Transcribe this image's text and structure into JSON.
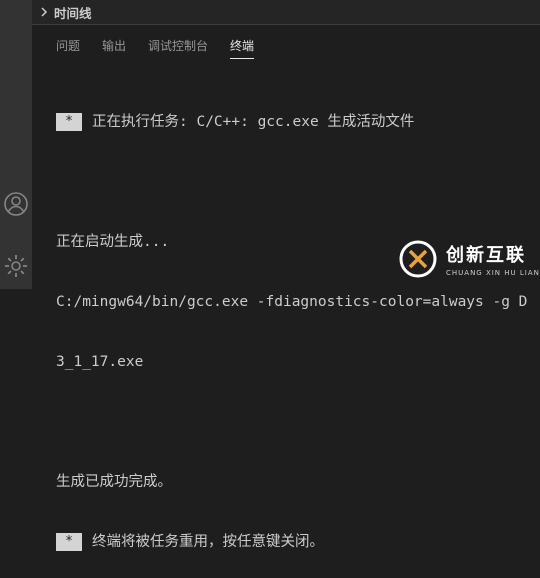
{
  "timeline": {
    "title": "时间线"
  },
  "panel": {
    "tabs": [
      {
        "label": "问题",
        "active": false
      },
      {
        "label": "输出",
        "active": false
      },
      {
        "label": "调试控制台",
        "active": false
      },
      {
        "label": "终端",
        "active": true
      }
    ]
  },
  "terminal": {
    "star": "*",
    "line1": "正在执行任务: C/C++: gcc.exe 生成活动文件",
    "line2": "正在启动生成...",
    "line3": "C:/mingw64/bin/gcc.exe -fdiagnostics-color=always -g D",
    "line4": "3_1_17.exe",
    "line5": "生成已成功完成。",
    "line6": "终端将被任务重用，按任意键关闭。"
  },
  "watermark": {
    "cn": "创新互联",
    "en": "CHUANG XIN HU LIAN"
  },
  "colors": {
    "background": "#1e1e1e",
    "activity_bar": "#333333",
    "text": "#cccccc",
    "inactive_tab": "#969696"
  }
}
